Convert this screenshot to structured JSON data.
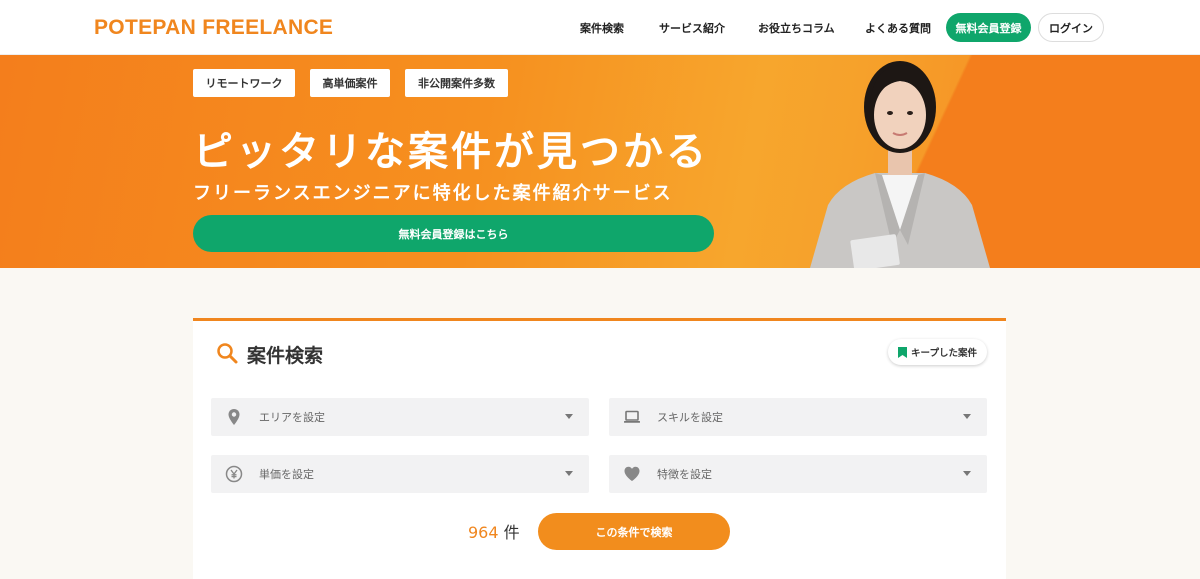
{
  "header": {
    "logo": "POTEPAN FREELANCE",
    "nav": [
      "案件検索",
      "サービス紹介",
      "お役立ちコラム",
      "よくある質問"
    ],
    "register_label": "無料会員登録",
    "login_label": "ログイン"
  },
  "hero": {
    "tags": [
      "リモートワーク",
      "高単価案件",
      "非公開案件多数"
    ],
    "title": "ピッタリな案件が見つかる",
    "subtitle": "フリーランスエンジニアに特化した案件紹介サービス",
    "cta_label": "無料会員登録はこちら"
  },
  "search": {
    "title": "案件検索",
    "keep_label": "キープした案件",
    "selects": {
      "area": "エリアを設定",
      "skill": "スキルを設定",
      "price": "単価を設定",
      "feature": "特徴を設定"
    },
    "count": "964",
    "count_unit": "件",
    "submit_label": "この条件で検索"
  },
  "colors": {
    "brand_orange": "#f0861e",
    "green": "#0fa66b"
  }
}
